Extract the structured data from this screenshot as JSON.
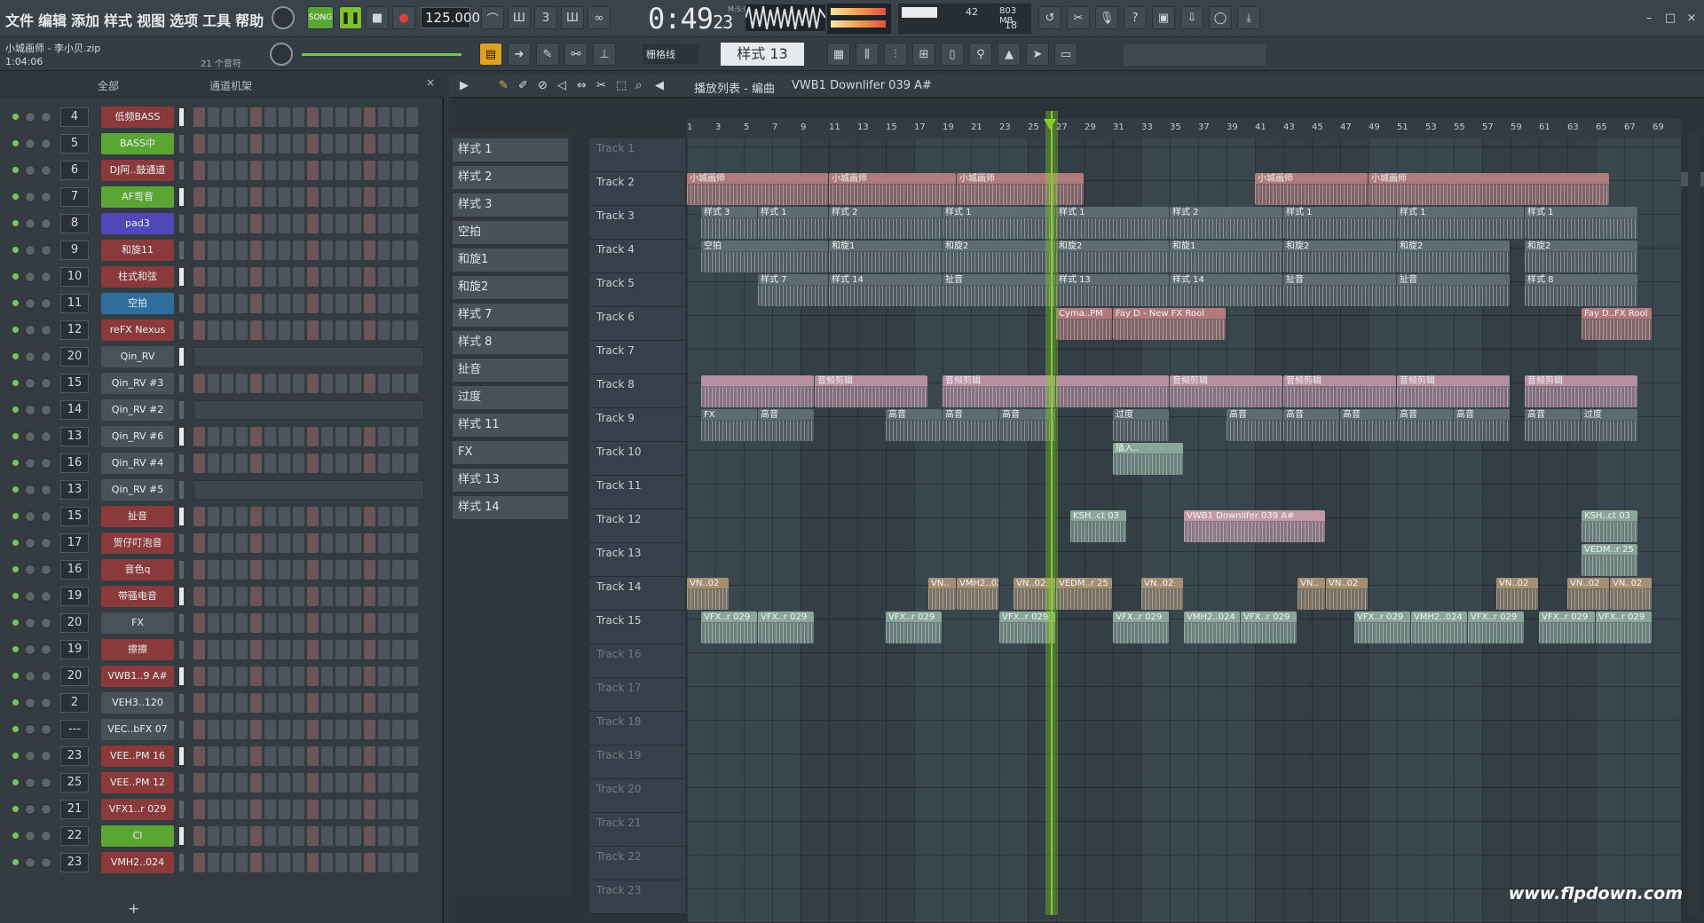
{
  "menu": [
    "文件",
    "编辑",
    "添加",
    "样式",
    "视图",
    "选项",
    "工具",
    "帮助"
  ],
  "transport": {
    "mode": "SONG",
    "tempo": "125.000",
    "time": "0:49",
    "time_ticks": "23",
    "time_label": "M:S:CS"
  },
  "cpu": {
    "value": "42",
    "memory": "803 MB",
    "polyphony": "18"
  },
  "project": {
    "file": "小城画师 - 李小贝.zip",
    "length": "1:04:06",
    "channels_count": "21 个音符"
  },
  "pattern": {
    "name": "样式 13",
    "snap": "栅格线"
  },
  "channel_rack": {
    "filter": "全部",
    "title": "通道机架",
    "channels": [
      {
        "num": "4",
        "name": "低频BASS",
        "color": "#8a3a3a"
      },
      {
        "num": "5",
        "name": "BASS中",
        "color": "#5aa534"
      },
      {
        "num": "6",
        "name": "DJ阿..鼓通道",
        "color": "#8a3a3a"
      },
      {
        "num": "7",
        "name": "AF弯音",
        "color": "#5aa534"
      },
      {
        "num": "8",
        "name": "pad3",
        "color": "#5247b8"
      },
      {
        "num": "9",
        "name": "和旋11",
        "color": "#8a3a3a"
      },
      {
        "num": "10",
        "name": "柱式和弦",
        "color": "#8a3a3a"
      },
      {
        "num": "11",
        "name": "空拍",
        "color": "#2f6d9c"
      },
      {
        "num": "12",
        "name": "reFX Nexus",
        "color": "#8a3a3a"
      },
      {
        "num": "20",
        "name": "Qin_RV",
        "color": "#4a5258"
      },
      {
        "num": "15",
        "name": "Qin_RV #3",
        "color": "#4a5258"
      },
      {
        "num": "14",
        "name": "Qin_RV #2",
        "color": "#4a5258"
      },
      {
        "num": "13",
        "name": "Qin_RV #6",
        "color": "#4a5258"
      },
      {
        "num": "16",
        "name": "Qin_RV #4",
        "color": "#4a5258"
      },
      {
        "num": "13",
        "name": "Qin_RV #5",
        "color": "#4a5258"
      },
      {
        "num": "15",
        "name": "扯音",
        "color": "#8a3a3a"
      },
      {
        "num": "17",
        "name": "贺仔叮泡音",
        "color": "#8a3a3a"
      },
      {
        "num": "16",
        "name": "音色q",
        "color": "#8a3a3a"
      },
      {
        "num": "19",
        "name": "带骚电音",
        "color": "#8a3a3a"
      },
      {
        "num": "20",
        "name": "FX",
        "color": "#4a5258"
      },
      {
        "num": "19",
        "name": "擦擦",
        "color": "#8a3a3a"
      },
      {
        "num": "20",
        "name": "VWB1..9 A#",
        "color": "#8a3a3a"
      },
      {
        "num": "2",
        "name": "VEH3..120",
        "color": "#4a5258"
      },
      {
        "num": "---",
        "name": "VEC..bFX 07",
        "color": "#4a5258"
      },
      {
        "num": "23",
        "name": "VEE..PM 16",
        "color": "#8a3a3a"
      },
      {
        "num": "25",
        "name": "VEE..PM 12",
        "color": "#8a3a3a"
      },
      {
        "num": "21",
        "name": "VFX1..r 029",
        "color": "#8a3a3a"
      },
      {
        "num": "22",
        "name": "CI",
        "color": "#5aa534"
      },
      {
        "num": "23",
        "name": "VMH2..024",
        "color": "#8a3a3a"
      }
    ]
  },
  "patterns": [
    "样式 1",
    "样式 2",
    "样式 3",
    "空拍",
    "和旋1",
    "和旋2",
    "样式 7",
    "样式 8",
    "扯音",
    "过度",
    "样式 11",
    "FX",
    "样式 13",
    "样式 14"
  ],
  "playlist": {
    "title": "播放列表 - 编曲",
    "current": "VWB1 Downlifer 039 A#",
    "ruler": [
      "1",
      "3",
      "5",
      "7",
      "9",
      "11",
      "13",
      "15",
      "17",
      "19",
      "21",
      "23",
      "25",
      "27",
      "29",
      "31",
      "33",
      "35",
      "37",
      "39",
      "41",
      "43",
      "45",
      "47",
      "49",
      "51",
      "53",
      "55",
      "57",
      "59",
      "61",
      "63",
      "65",
      "67",
      "69"
    ],
    "tracks": [
      "Track 1",
      "Track 2",
      "Track 3",
      "Track 4",
      "Track 5",
      "Track 6",
      "Track 7",
      "Track 8",
      "Track 9",
      "Track 10",
      "Track 11",
      "Track 12",
      "Track 13",
      "Track 14",
      "Track 15",
      "Track 16",
      "Track 17",
      "Track 18",
      "Track 19",
      "Track 20",
      "Track 21",
      "Track 22",
      "Track 23"
    ],
    "clips": [
      {
        "t": 1,
        "s": 1,
        "l": 10,
        "n": "小城画师",
        "c": "#b07a7a"
      },
      {
        "t": 1,
        "s": 11,
        "l": 9,
        "n": "小城画师",
        "c": "#b07a7a"
      },
      {
        "t": 1,
        "s": 20,
        "l": 9,
        "n": "小城画师",
        "c": "#b07a7a"
      },
      {
        "t": 1,
        "s": 41,
        "l": 8,
        "n": "小城画师",
        "c": "#b07a7a"
      },
      {
        "t": 1,
        "s": 49,
        "l": 17,
        "n": "小城画师",
        "c": "#b07a7a"
      },
      {
        "t": 2,
        "s": 2,
        "l": 4,
        "n": "样式 3",
        "c": "#5f6b72"
      },
      {
        "t": 2,
        "s": 6,
        "l": 5,
        "n": "样式 1",
        "c": "#5f6b72"
      },
      {
        "t": 2,
        "s": 11,
        "l": 8,
        "n": "样式 2",
        "c": "#5f6b72"
      },
      {
        "t": 2,
        "s": 19,
        "l": 8,
        "n": "样式 1",
        "c": "#5f6b72"
      },
      {
        "t": 2,
        "s": 27,
        "l": 8,
        "n": "样式 1",
        "c": "#5f6b72"
      },
      {
        "t": 2,
        "s": 35,
        "l": 8,
        "n": "样式 2",
        "c": "#5f6b72"
      },
      {
        "t": 2,
        "s": 43,
        "l": 8,
        "n": "样式 1",
        "c": "#5f6b72"
      },
      {
        "t": 2,
        "s": 51,
        "l": 9,
        "n": "样式 1",
        "c": "#5f6b72"
      },
      {
        "t": 2,
        "s": 60,
        "l": 8,
        "n": "样式 1",
        "c": "#5f6b72"
      },
      {
        "t": 3,
        "s": 2,
        "l": 9,
        "n": "空拍",
        "c": "#5f6b72"
      },
      {
        "t": 3,
        "s": 11,
        "l": 8,
        "n": "和旋1",
        "c": "#5f6b72"
      },
      {
        "t": 3,
        "s": 19,
        "l": 8,
        "n": "和旋2",
        "c": "#5f6b72"
      },
      {
        "t": 3,
        "s": 27,
        "l": 8,
        "n": "和旋2",
        "c": "#5f6b72"
      },
      {
        "t": 3,
        "s": 35,
        "l": 8,
        "n": "和旋1",
        "c": "#5f6b72"
      },
      {
        "t": 3,
        "s": 43,
        "l": 8,
        "n": "和旋2",
        "c": "#5f6b72"
      },
      {
        "t": 3,
        "s": 51,
        "l": 8,
        "n": "和旋2",
        "c": "#5f6b72"
      },
      {
        "t": 3,
        "s": 60,
        "l": 8,
        "n": "和旋2",
        "c": "#5f6b72"
      },
      {
        "t": 4,
        "s": 6,
        "l": 5,
        "n": "样式 7",
        "c": "#5f6b72"
      },
      {
        "t": 4,
        "s": 11,
        "l": 8,
        "n": "样式 14",
        "c": "#5f6b72"
      },
      {
        "t": 4,
        "s": 19,
        "l": 8,
        "n": "扯音",
        "c": "#5f6b72"
      },
      {
        "t": 4,
        "s": 27,
        "l": 8,
        "n": "样式 13",
        "c": "#5f6b72"
      },
      {
        "t": 4,
        "s": 35,
        "l": 8,
        "n": "样式 14",
        "c": "#5f6b72"
      },
      {
        "t": 4,
        "s": 43,
        "l": 8,
        "n": "扯音",
        "c": "#5f6b72"
      },
      {
        "t": 4,
        "s": 51,
        "l": 8,
        "n": "扯音",
        "c": "#5f6b72"
      },
      {
        "t": 4,
        "s": 60,
        "l": 8,
        "n": "样式 8",
        "c": "#5f6b72"
      },
      {
        "t": 5,
        "s": 27,
        "l": 4,
        "n": "Cyma..PM",
        "c": "#b07a7a"
      },
      {
        "t": 5,
        "s": 31,
        "l": 8,
        "n": "Fay D - New FX Rool",
        "c": "#b07a7a"
      },
      {
        "t": 5,
        "s": 64,
        "l": 5,
        "n": "Fay D..FX Rool",
        "c": "#b07a7a"
      },
      {
        "t": 7,
        "s": 2,
        "l": 8,
        "n": "",
        "c": "#b58fa2"
      },
      {
        "t": 7,
        "s": 10,
        "l": 8,
        "n": "音频剪辑",
        "c": "#b58fa2"
      },
      {
        "t": 7,
        "s": 19,
        "l": 8,
        "n": "音频剪辑",
        "c": "#b58fa2"
      },
      {
        "t": 7,
        "s": 27,
        "l": 8,
        "n": "",
        "c": "#b58fa2"
      },
      {
        "t": 7,
        "s": 35,
        "l": 8,
        "n": "音频剪辑",
        "c": "#b58fa2"
      },
      {
        "t": 7,
        "s": 43,
        "l": 8,
        "n": "音频剪辑",
        "c": "#b58fa2"
      },
      {
        "t": 7,
        "s": 51,
        "l": 8,
        "n": "音频剪辑",
        "c": "#b58fa2"
      },
      {
        "t": 7,
        "s": 60,
        "l": 8,
        "n": "音频剪辑",
        "c": "#b58fa2"
      },
      {
        "t": 8,
        "s": 2,
        "l": 4,
        "n": "FX",
        "c": "#5f6b72"
      },
      {
        "t": 8,
        "s": 6,
        "l": 4,
        "n": "高音",
        "c": "#5f6b72"
      },
      {
        "t": 8,
        "s": 15,
        "l": 4,
        "n": "高音",
        "c": "#5f6b72"
      },
      {
        "t": 8,
        "s": 19,
        "l": 4,
        "n": "高音",
        "c": "#5f6b72"
      },
      {
        "t": 8,
        "s": 23,
        "l": 4,
        "n": "高音",
        "c": "#5f6b72"
      },
      {
        "t": 8,
        "s": 31,
        "l": 4,
        "n": "过度",
        "c": "#5f6b72"
      },
      {
        "t": 8,
        "s": 39,
        "l": 4,
        "n": "高音",
        "c": "#5f6b72"
      },
      {
        "t": 8,
        "s": 43,
        "l": 4,
        "n": "高音",
        "c": "#5f6b72"
      },
      {
        "t": 8,
        "s": 47,
        "l": 4,
        "n": "高音",
        "c": "#5f6b72"
      },
      {
        "t": 8,
        "s": 51,
        "l": 4,
        "n": "高音",
        "c": "#5f6b72"
      },
      {
        "t": 8,
        "s": 55,
        "l": 4,
        "n": "高音",
        "c": "#5f6b72"
      },
      {
        "t": 8,
        "s": 60,
        "l": 4,
        "n": "高音",
        "c": "#5f6b72"
      },
      {
        "t": 8,
        "s": 64,
        "l": 4,
        "n": "过度",
        "c": "#5f6b72"
      },
      {
        "t": 9,
        "s": 31,
        "l": 5,
        "n": "插入..",
        "c": "#8aa699"
      },
      {
        "t": 11,
        "s": 28,
        "l": 4,
        "n": "KSH..ct 03",
        "c": "#8aa699"
      },
      {
        "t": 11,
        "s": 36,
        "l": 10,
        "n": "VWB1 Downlifer 039 A#",
        "c": "#c29aa6"
      },
      {
        "t": 11,
        "s": 64,
        "l": 4,
        "n": "KSH..ct 03",
        "c": "#8aa699"
      },
      {
        "t": 12,
        "s": 64,
        "l": 4,
        "n": "VEDM..r 25",
        "c": "#8aa699"
      },
      {
        "t": 13,
        "s": 1,
        "l": 3,
        "n": "VN..02",
        "c": "#a58f73"
      },
      {
        "t": 13,
        "s": 18,
        "l": 2,
        "n": "VN..",
        "c": "#a58f73"
      },
      {
        "t": 13,
        "s": 20,
        "l": 3,
        "n": "VMH2..024",
        "c": "#a58f73"
      },
      {
        "t": 13,
        "s": 24,
        "l": 3,
        "n": "VN..02",
        "c": "#a58f73"
      },
      {
        "t": 13,
        "s": 27,
        "l": 4,
        "n": "VEDM..r 25",
        "c": "#a58f73"
      },
      {
        "t": 13,
        "s": 33,
        "l": 3,
        "n": "VN..02",
        "c": "#a58f73"
      },
      {
        "t": 13,
        "s": 44,
        "l": 2,
        "n": "VN..",
        "c": "#a58f73"
      },
      {
        "t": 13,
        "s": 46,
        "l": 3,
        "n": "VN..02",
        "c": "#a58f73"
      },
      {
        "t": 13,
        "s": 58,
        "l": 3,
        "n": "VN..02",
        "c": "#a58f73"
      },
      {
        "t": 13,
        "s": 63,
        "l": 3,
        "n": "VN..02",
        "c": "#a58f73"
      },
      {
        "t": 13,
        "s": 66,
        "l": 3,
        "n": "VN..02",
        "c": "#a58f73"
      },
      {
        "t": 14,
        "s": 2,
        "l": 4,
        "n": "VFX..r 029",
        "c": "#8aa699"
      },
      {
        "t": 14,
        "s": 6,
        "l": 4,
        "n": "VFX..r 029",
        "c": "#8aa699"
      },
      {
        "t": 14,
        "s": 15,
        "l": 4,
        "n": "VFX..r 029",
        "c": "#8aa699"
      },
      {
        "t": 14,
        "s": 23,
        "l": 4,
        "n": "VFX..r 029",
        "c": "#8aa699"
      },
      {
        "t": 14,
        "s": 31,
        "l": 4,
        "n": "VFX..r 029",
        "c": "#8aa699"
      },
      {
        "t": 14,
        "s": 36,
        "l": 4,
        "n": "VMH2..024",
        "c": "#8aa699"
      },
      {
        "t": 14,
        "s": 40,
        "l": 4,
        "n": "VFX..r 029",
        "c": "#8aa699"
      },
      {
        "t": 14,
        "s": 48,
        "l": 4,
        "n": "VFX..r 029",
        "c": "#8aa699"
      },
      {
        "t": 14,
        "s": 52,
        "l": 4,
        "n": "VMH2..024",
        "c": "#8aa699"
      },
      {
        "t": 14,
        "s": 56,
        "l": 4,
        "n": "VFX..r 029",
        "c": "#8aa699"
      },
      {
        "t": 14,
        "s": 61,
        "l": 4,
        "n": "VFX..r 029",
        "c": "#8aa699"
      },
      {
        "t": 14,
        "s": 65,
        "l": 4,
        "n": "VFX..r 029",
        "c": "#8aa699"
      }
    ]
  },
  "watermark": "www.flpdown.com"
}
